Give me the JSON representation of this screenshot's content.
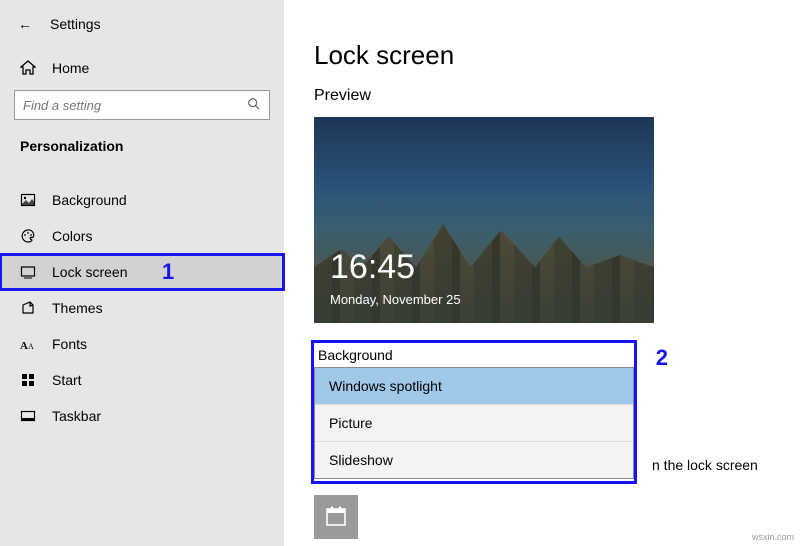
{
  "window": {
    "title": "Settings"
  },
  "sidebar": {
    "home": "Home",
    "search_placeholder": "Find a setting",
    "category": "Personalization",
    "items": [
      {
        "label": "Background"
      },
      {
        "label": "Colors"
      },
      {
        "label": "Lock screen"
      },
      {
        "label": "Themes"
      },
      {
        "label": "Fonts"
      },
      {
        "label": "Start"
      },
      {
        "label": "Taskbar"
      }
    ],
    "selected_index": 2
  },
  "annotations": {
    "one": "1",
    "two": "2"
  },
  "main": {
    "title": "Lock screen",
    "preview_label": "Preview",
    "clock": "16:45",
    "date": "Monday, November 25",
    "background_label": "Background",
    "options": [
      "Windows spotlight",
      "Picture",
      "Slideshow"
    ],
    "selected_option": 0,
    "truncated_hint": "n the lock screen"
  },
  "watermark": "wsxin.com"
}
